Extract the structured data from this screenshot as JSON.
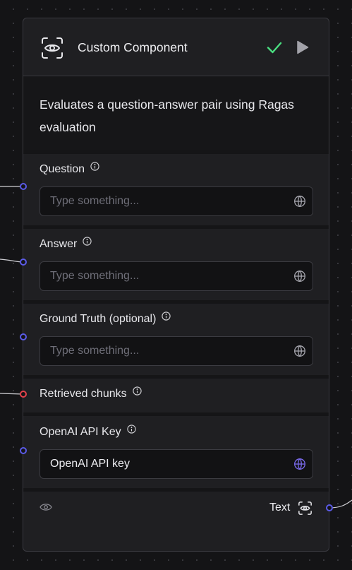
{
  "node": {
    "title": "Custom Component",
    "description": "Evaluates a question-answer pair using Ragas evaluation",
    "header_icon": "eye-scan-icon",
    "status_icon": "check-icon",
    "run_icon": "play-icon"
  },
  "fields": {
    "question": {
      "label": "Question",
      "placeholder": "Type something..."
    },
    "answer": {
      "label": "Answer",
      "placeholder": "Type something..."
    },
    "ground_truth": {
      "label": "Ground Truth (optional)",
      "placeholder": "Type something..."
    },
    "retrieved_chunks": {
      "label": "Retrieved chunks"
    },
    "openai_api_key": {
      "label": "OpenAI API Key",
      "value": "OpenAI API key"
    }
  },
  "output": {
    "label": "Text",
    "icon": "eye-scan-icon",
    "visibility_icon": "eye-icon"
  },
  "colors": {
    "handle_blue": "#5b5be8",
    "handle_red": "#e4424c",
    "check_green": "#4ade80",
    "node_bg": "#1f1f22"
  }
}
